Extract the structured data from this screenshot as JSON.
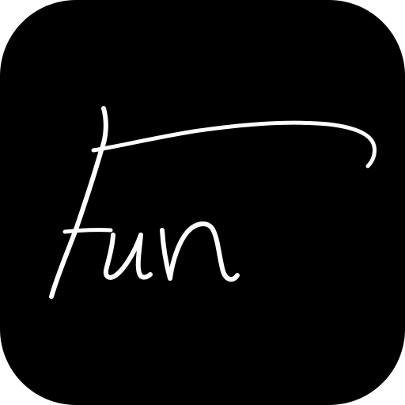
{
  "app_icon": {
    "logo_text": "Fun",
    "background_color": "#000000",
    "foreground_color": "#ffffff",
    "style": "handwritten-script"
  }
}
